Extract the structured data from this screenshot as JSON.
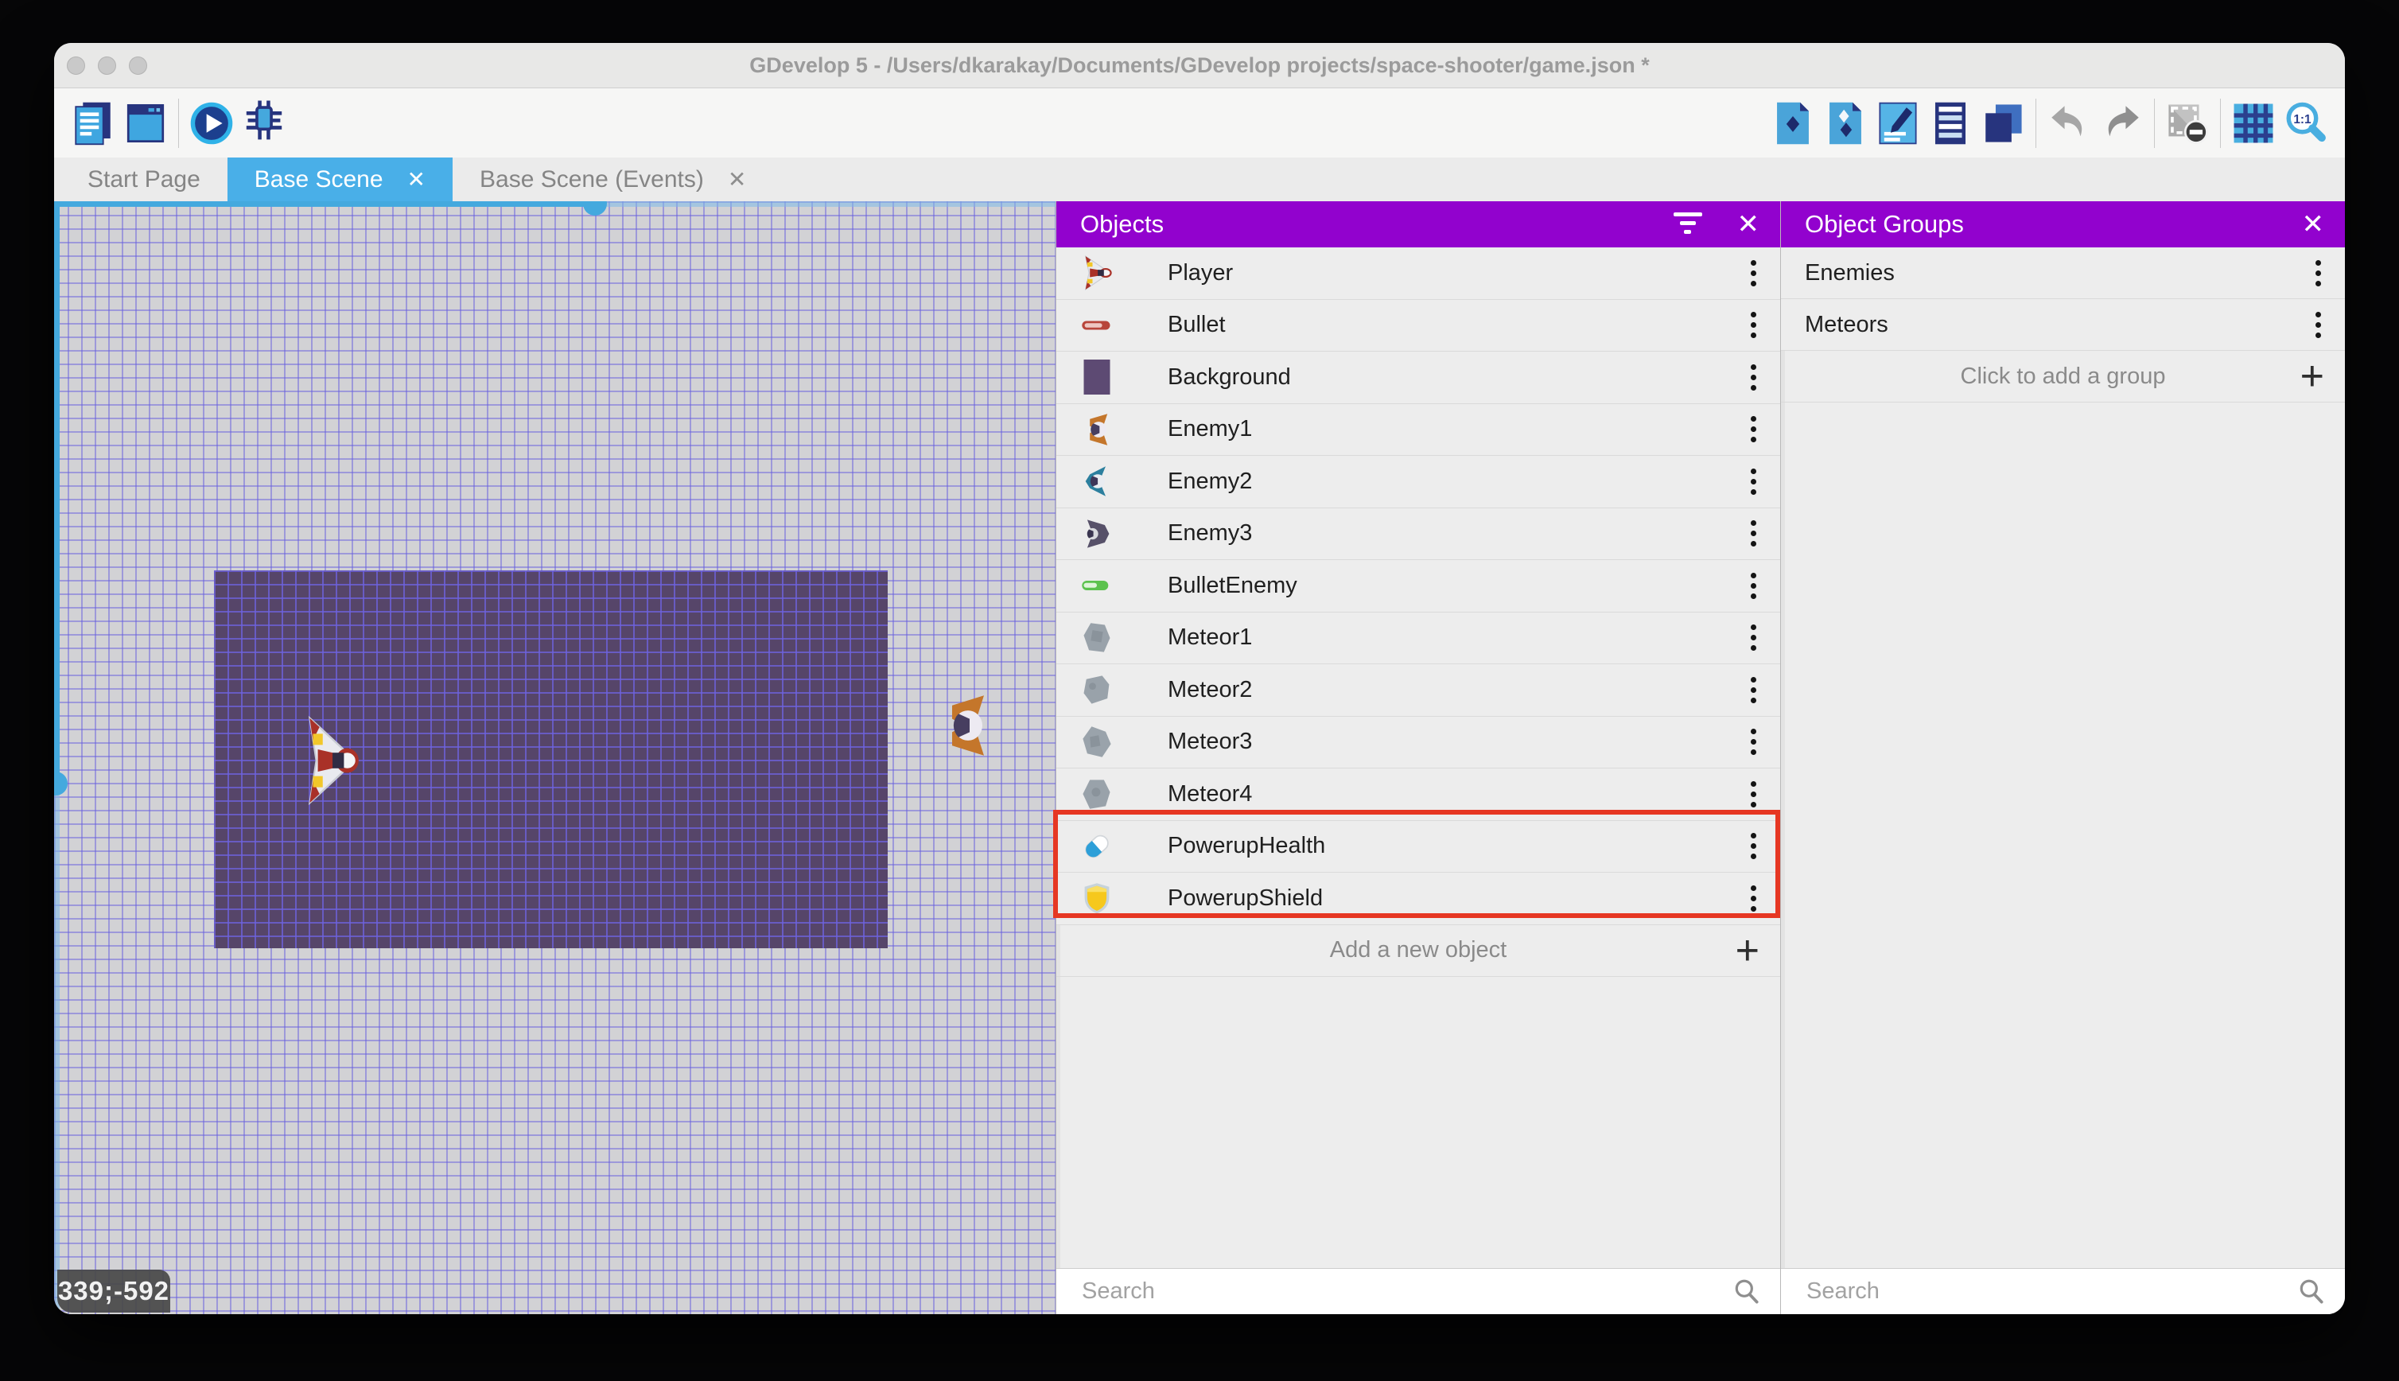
{
  "window_title": "GDevelop 5 - /Users/dkarakay/Documents/GDevelop projects/space-shooter/game.json *",
  "toolbar": {
    "left_groups": [
      [
        "project-manager-icon",
        "export-project-icon"
      ],
      [
        "preview-play-icon",
        "debug-icon"
      ]
    ],
    "right_groups": [
      [
        "objects-editor-icon",
        "object-groups-editor-icon",
        "properties-icon",
        "instances-list-icon",
        "layers-icon"
      ],
      [
        "undo-icon",
        "redo-icon"
      ],
      [
        "window-mask-icon"
      ],
      [
        "grid-icon",
        "zoom-1-1-icon"
      ]
    ]
  },
  "tabs": [
    {
      "label": "Start Page",
      "active": false,
      "closable": false
    },
    {
      "label": "Base Scene",
      "active": true,
      "closable": true
    },
    {
      "label": "Base Scene (Events)",
      "active": false,
      "closable": true
    }
  ],
  "canvas": {
    "cursor_coordinates": "339;-592",
    "instances": [
      {
        "name": "Player"
      },
      {
        "name": "Enemy1"
      }
    ]
  },
  "objects_panel": {
    "title": "Objects",
    "header_icons": [
      "filter-icon",
      "close-icon"
    ],
    "items": [
      {
        "label": "Player",
        "icon": "player-ship-icon",
        "highlighted": false
      },
      {
        "label": "Bullet",
        "icon": "bullet-icon",
        "highlighted": false
      },
      {
        "label": "Background",
        "icon": "background-swatch-icon",
        "highlighted": false
      },
      {
        "label": "Enemy1",
        "icon": "enemy1-ship-icon",
        "highlighted": false
      },
      {
        "label": "Enemy2",
        "icon": "enemy2-ship-icon",
        "highlighted": false
      },
      {
        "label": "Enemy3",
        "icon": "enemy3-ship-icon",
        "highlighted": false
      },
      {
        "label": "BulletEnemy",
        "icon": "bullet-enemy-icon",
        "highlighted": false
      },
      {
        "label": "Meteor1",
        "icon": "meteor1-icon",
        "highlighted": false
      },
      {
        "label": "Meteor2",
        "icon": "meteor2-icon",
        "highlighted": false
      },
      {
        "label": "Meteor3",
        "icon": "meteor3-icon",
        "highlighted": false
      },
      {
        "label": "Meteor4",
        "icon": "meteor4-icon",
        "highlighted": false
      },
      {
        "label": "PowerupHealth",
        "icon": "powerup-health-icon",
        "highlighted": true
      },
      {
        "label": "PowerupShield",
        "icon": "powerup-shield-icon",
        "highlighted": true
      }
    ],
    "add_label": "Add a new object",
    "search_placeholder": "Search"
  },
  "groups_panel": {
    "title": "Object Groups",
    "items": [
      {
        "label": "Enemies"
      },
      {
        "label": "Meteors"
      }
    ],
    "add_label": "Click to add a group",
    "search_placeholder": "Search"
  },
  "colors": {
    "accent_blue": "#49afe8",
    "panel_header_purple": "#9202ce",
    "highlight_red": "#e63723",
    "scene_purple": "#564569"
  }
}
